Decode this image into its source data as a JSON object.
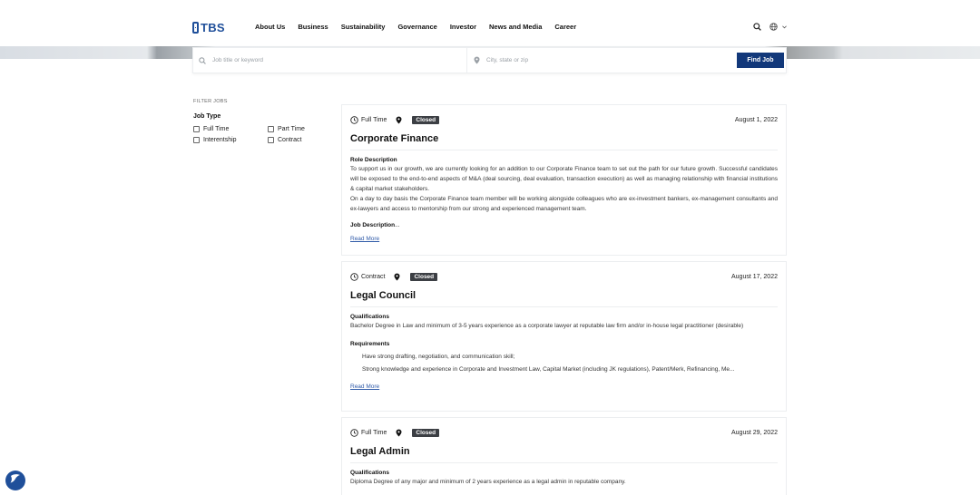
{
  "header": {
    "logo_text": "TBS",
    "nav": [
      "About Us",
      "Business",
      "Sustainability",
      "Governance",
      "Investor",
      "News and Media",
      "Career"
    ],
    "icons": [
      "search-icon",
      "globe-icon",
      "chevron-down-icon"
    ]
  },
  "search": {
    "keyword_placeholder": "Job title or keyword",
    "location_placeholder": "City, state or zip",
    "find_label": "Find Job"
  },
  "filter": {
    "title": "FILTER JOBS",
    "job_type_label": "Job Type",
    "options": [
      "Full Time",
      "Part Time",
      "Interentship",
      "Contract"
    ]
  },
  "jobs": [
    {
      "type": "Full Time",
      "status": "Closed",
      "date": "August 1, 2022",
      "title": "Corporate Finance",
      "section1": "Role Description",
      "body": "To support us in our growth, we are currently looking for an addition to our Corporate Finance team to set out the path for our future growth. Successful candidates will be exposed to the end-to-end aspects of M&A (deal sourcing, deal evaluation, transaction execution) as well as managing relationship with financial institutions & capital market stakeholders.",
      "body2": "On a day to day basis the Corporate Finance team member will be working alongside colleagues who are ex-investment bankers, ex-management consultants and ex-lawyers and access to mentorship from our strong and experienced management team.",
      "section2": "Job Description",
      "section2_suffix": "...",
      "read_more": "Read More"
    },
    {
      "type": "Contract",
      "status": "Closed",
      "date": "August 17, 2022",
      "title": "Legal Council",
      "section1": "Qualifications",
      "body": "Bachelor Degree in Law and minimum of 3-5 years experience as a corporate lawyer at reputable law firm and/or in-house legal practitioner (desirable)",
      "section2": "Requirements",
      "bullets": [
        "Have strong drafting, negotiation, and communication skill;",
        "Strong knowledge and experience in Corporate and Investment Law, Capital Market (including JK regulations), Patent/Merk, Refinancing, Me..."
      ],
      "read_more": "Read More"
    },
    {
      "type": "Full Time",
      "status": "Closed",
      "date": "August 29, 2022",
      "title": "Legal Admin",
      "section1": "Qualifications",
      "body": "Diploma Degree of any major and minimum of 2 years experience as a legal admin in reputable company."
    }
  ],
  "colors": {
    "brand": "#1f4f9a",
    "button": "#12387a",
    "badge": "#3c3f44",
    "link": "#2f5aa8"
  }
}
